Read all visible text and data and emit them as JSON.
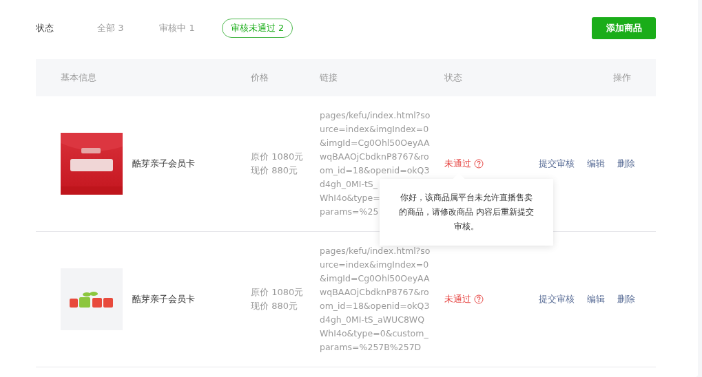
{
  "filter": {
    "label": "状态",
    "tabs": [
      {
        "label": "全部 3",
        "selected": false
      },
      {
        "label": "审核中 1",
        "selected": false
      },
      {
        "label": "审核未通过 2",
        "selected": true
      }
    ]
  },
  "add_button": "添加商品",
  "table": {
    "columns": [
      "基本信息",
      "价格",
      "链接",
      "状态",
      "操作"
    ],
    "rows": [
      {
        "name": "酷芽亲子会员卡",
        "price_original": "原价 1080元",
        "price_current": "现价 880元",
        "link_lines": [
          "pages/kefu/index.html?so",
          "urce=index&imgIndex=0",
          "&imgId=Cg0Ohl50OeyAA",
          "wqBAAOjCbdknP8767&ro",
          "om_id=18&openid=okQ3",
          "d4gh_0MI-tS_",
          "WhI4o&type=",
          "params=%25"
        ],
        "status": "未通过",
        "tooltip": "你好，该商品属平台未允许直播售卖的商品，请修改商品 内容后重新提交审核。",
        "actions": [
          "提交审核",
          "编辑",
          "删除"
        ]
      },
      {
        "name": "酷芽亲子会员卡",
        "price_original": "原价 1080元",
        "price_current": "现价 880元",
        "link_lines": [
          "pages/kefu/index.html?so",
          "urce=index&imgIndex=0",
          "&imgId=Cg0Ohl50OeyAA",
          "wqBAAOjCbdknP8767&ro",
          "om_id=18&openid=okQ3",
          "d4gh_0MI-tS_aWUC8WQ",
          "WhI4o&type=0&custom_",
          "params=%257B%257D"
        ],
        "status": "未通过",
        "actions": [
          "提交审核",
          "编辑",
          "删除"
        ]
      }
    ]
  }
}
